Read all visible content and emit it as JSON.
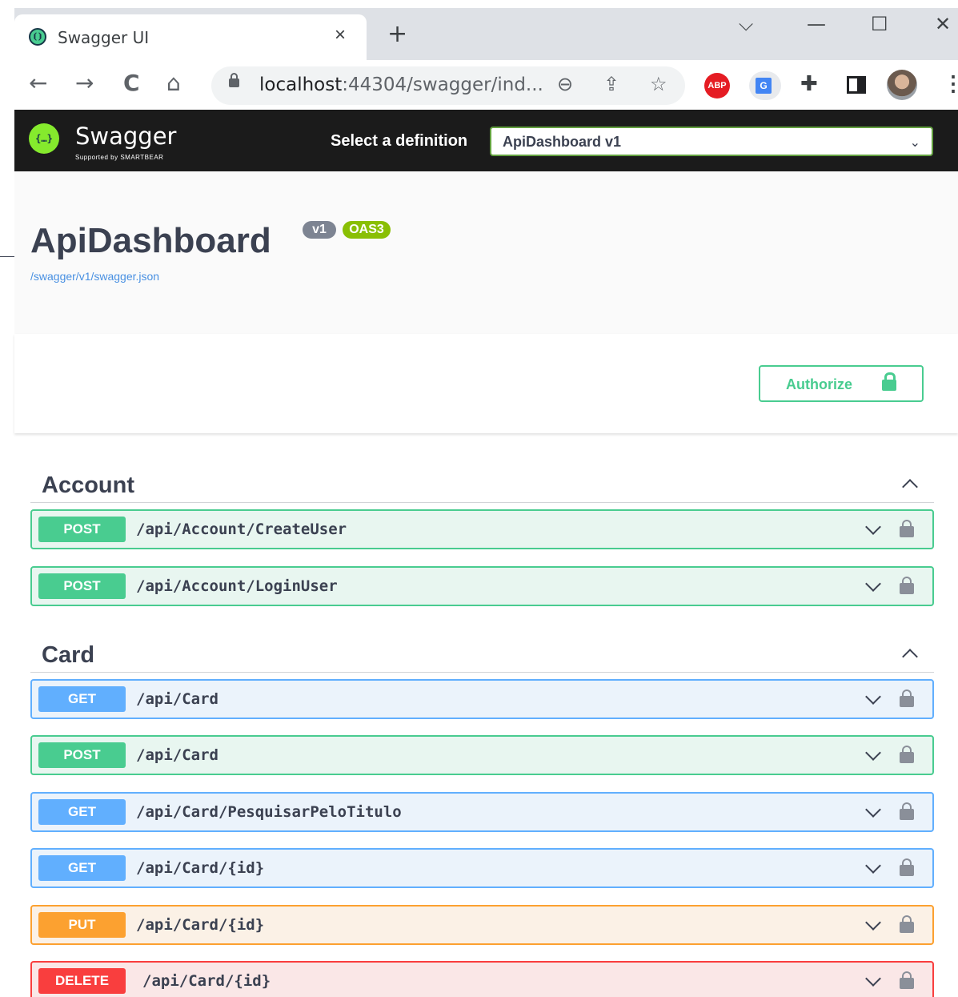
{
  "browser": {
    "tab_title": "Swagger UI",
    "tab_close": "×",
    "new_tab": "+",
    "window_controls": {
      "menu": "⌵",
      "minimize": "—",
      "maximize": "☐",
      "close": "✕"
    },
    "nav": {
      "back": "←",
      "forward": "→",
      "reload": "C",
      "home": "⌂"
    },
    "url_host": "localhost",
    "url_rest": ":44304/swagger/ind...",
    "omnibox_icons": {
      "zoom": "⊖",
      "share": "⇪",
      "bookmark": "☆"
    },
    "extensions": {
      "abp_label": "ABP",
      "translate_label": "G",
      "puzzle": "✚",
      "menu": "⋮"
    }
  },
  "topbar": {
    "brand": "Swagger",
    "brand_sub": "Supported by SMARTBEAR",
    "logo_glyph": "{…}",
    "definition_label": "Select a definition",
    "definition_value": "ApiDashboard v1",
    "definition_arrow": "⌄"
  },
  "info": {
    "title": "ApiDashboard",
    "version_badge": "v1",
    "oas_badge": "OAS3",
    "spec_link": "/swagger/v1/swagger.json"
  },
  "authorize": {
    "label": "Authorize"
  },
  "tags": [
    {
      "name": "Account",
      "operations": [
        {
          "method": "POST",
          "path": "/api/Account/CreateUser"
        },
        {
          "method": "POST",
          "path": "/api/Account/LoginUser"
        }
      ]
    },
    {
      "name": "Card",
      "operations": [
        {
          "method": "GET",
          "path": "/api/Card"
        },
        {
          "method": "POST",
          "path": "/api/Card"
        },
        {
          "method": "GET",
          "path": "/api/Card/PesquisarPeloTitulo"
        },
        {
          "method": "GET",
          "path": "/api/Card/{id}"
        },
        {
          "method": "PUT",
          "path": "/api/Card/{id}"
        },
        {
          "method": "DELETE",
          "path": "/api/Card/{id}"
        }
      ]
    }
  ],
  "colors": {
    "post": "#49cc90",
    "get": "#61affe",
    "put": "#fca130",
    "delete": "#f93e3e",
    "topbar": "#1b1b1b",
    "swagger_green": "#85ea2d"
  }
}
